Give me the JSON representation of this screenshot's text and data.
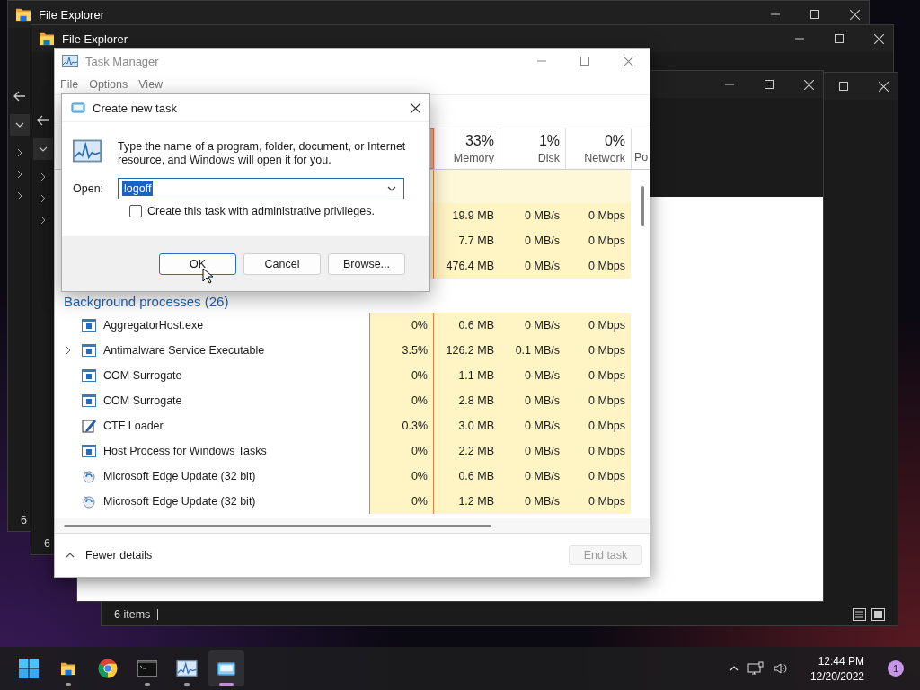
{
  "explorers": [
    {
      "kind": "dark",
      "title": "File Explorer",
      "status": "6"
    },
    {
      "kind": "dark",
      "title": "File Explorer",
      "status": "6"
    },
    {
      "kind": "dark",
      "status": "6 items"
    },
    {
      "kind": "light"
    }
  ],
  "task_manager": {
    "title": "Task Manager",
    "menu": [
      "File",
      "Options",
      "View"
    ],
    "columns": [
      {
        "percent": "33%",
        "label": "Memory"
      },
      {
        "percent": "1%",
        "label": "Disk"
      },
      {
        "percent": "0%",
        "label": "Network"
      },
      {
        "label": "Po"
      }
    ],
    "app_rows": [
      {
        "memory": "19.9 MB",
        "disk": "0 MB/s",
        "network": "0 Mbps"
      },
      {
        "memory": "7.7 MB",
        "disk": "0 MB/s",
        "network": "0 Mbps"
      },
      {
        "memory": "476.4 MB",
        "disk": "0 MB/s",
        "network": "0 Mbps"
      }
    ],
    "section": "Background processes (26)",
    "processes": [
      {
        "kind": "app",
        "name": "AggregatorHost.exe",
        "expandable": false,
        "cpu": "0%",
        "memory": "0.6 MB",
        "disk": "0 MB/s",
        "network": "0 Mbps"
      },
      {
        "kind": "app",
        "name": "Antimalware Service Executable",
        "expandable": true,
        "cpu": "3.5%",
        "memory": "126.2 MB",
        "disk": "0.1 MB/s",
        "network": "0 Mbps"
      },
      {
        "kind": "app",
        "name": "COM Surrogate",
        "expandable": false,
        "cpu": "0%",
        "memory": "1.1 MB",
        "disk": "0 MB/s",
        "network": "0 Mbps"
      },
      {
        "kind": "app",
        "name": "COM Surrogate",
        "expandable": false,
        "cpu": "0%",
        "memory": "2.8 MB",
        "disk": "0 MB/s",
        "network": "0 Mbps"
      },
      {
        "kind": "pen",
        "name": "CTF Loader",
        "expandable": false,
        "cpu": "0.3%",
        "memory": "3.0 MB",
        "disk": "0 MB/s",
        "network": "0 Mbps"
      },
      {
        "kind": "app",
        "name": "Host Process for Windows Tasks",
        "expandable": false,
        "cpu": "0%",
        "memory": "2.2 MB",
        "disk": "0 MB/s",
        "network": "0 Mbps"
      },
      {
        "kind": "update",
        "name": "Microsoft Edge Update (32 bit)",
        "expandable": false,
        "cpu": "0%",
        "memory": "0.6 MB",
        "disk": "0 MB/s",
        "network": "0 Mbps"
      },
      {
        "kind": "update",
        "name": "Microsoft Edge Update (32 bit)",
        "expandable": false,
        "cpu": "0%",
        "memory": "1.2 MB",
        "disk": "0 MB/s",
        "network": "0 Mbps"
      }
    ],
    "details_toggle": "Fewer details",
    "end_task": {
      "label": "End task",
      "disabled": true
    }
  },
  "dialog": {
    "title": "Create new task",
    "message": "Type the name of a program, folder, document, or Internet resource, and Windows will open it for you.",
    "open_label": "Open:",
    "open_value": "logoff",
    "admin": {
      "label": "Create this task with administrative privileges.",
      "checked": false
    },
    "buttons": [
      {
        "label": "OK",
        "default": true
      },
      {
        "label": "Cancel",
        "default": false
      },
      {
        "label": "Browse...",
        "default": false
      }
    ]
  },
  "taskbar": {
    "apps": [
      {
        "kind": "start",
        "running": false,
        "selected": false
      },
      {
        "kind": "explorer",
        "running": true,
        "selected": false
      },
      {
        "kind": "chrome",
        "running": false,
        "selected": false
      },
      {
        "kind": "terminal",
        "running": true,
        "selected": false
      },
      {
        "kind": "taskmgr",
        "running": true,
        "selected": false
      },
      {
        "kind": "run",
        "running": true,
        "selected": true
      }
    ],
    "time": "12:44 PM",
    "date": "12/20/2022",
    "notifications": "1"
  }
}
